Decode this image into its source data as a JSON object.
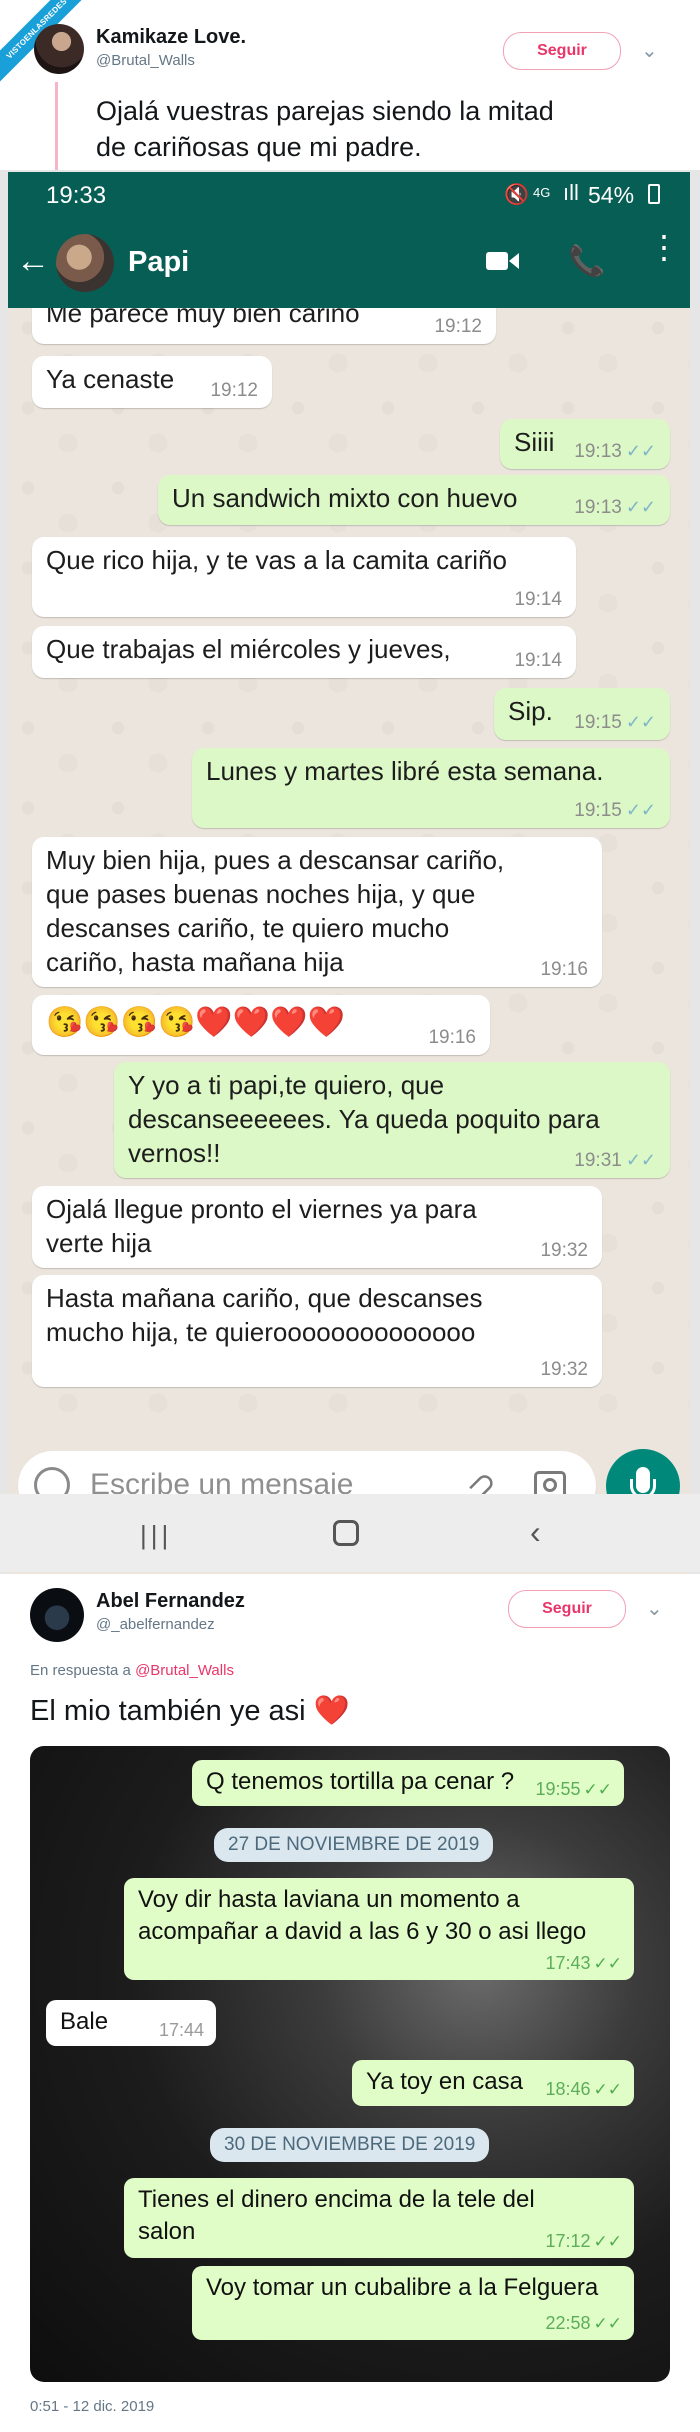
{
  "watermark": "VISTOENLASREDES",
  "tweet1": {
    "name": "Kamikaze Love.",
    "handle": "@Brutal_Walls",
    "follow_label": "Seguir",
    "text_line1": "Ojalá vuestras parejas siendo la mitad",
    "text_line2": "de cariñosas que mi padre."
  },
  "whatsapp": {
    "status_time": "19:33",
    "status_network": "4G",
    "battery": "54%",
    "contact_name": "Papi",
    "messages": [
      {
        "dir": "in",
        "text": "Me parece muy bien cariño",
        "time": "19:12"
      },
      {
        "dir": "in",
        "text": "Ya cenaste",
        "time": "19:12"
      },
      {
        "dir": "out",
        "text": "Siiii",
        "time": "19:13"
      },
      {
        "dir": "out",
        "text": "Un sandwich mixto con huevo",
        "time": "19:13"
      },
      {
        "dir": "in",
        "text": "Que rico hija, y te vas a la camita cariño",
        "time": "19:14"
      },
      {
        "dir": "in",
        "text": "Que trabajas el miércoles y jueves,",
        "time": "19:14"
      },
      {
        "dir": "out",
        "text": "Sip.",
        "time": "19:15"
      },
      {
        "dir": "out",
        "text": "Lunes y martes libré esta semana.",
        "time": "19:15"
      },
      {
        "dir": "in",
        "line1": "Muy bien hija, pues a descansar cariño,",
        "line2": "que pases buenas noches hija, y que",
        "line3": "descanses cariño, te quiero mucho",
        "line4": "cariño, hasta mañana hija",
        "time": "19:16"
      },
      {
        "dir": "in",
        "text": "😘😘😘😘❤️❤️❤️❤️",
        "time": "19:16"
      },
      {
        "dir": "out",
        "line1": "Y yo a ti papi,te quiero, que",
        "line2": "descanseeeeees. Ya queda poquito para",
        "line3": "vernos!!",
        "time": "19:31"
      },
      {
        "dir": "in",
        "line1": "Ojalá llegue pronto el viernes ya para",
        "line2": "verte hija",
        "time": "19:32"
      },
      {
        "dir": "in",
        "line1": "Hasta mañana cariño, que descanses",
        "line2": "mucho hija, te quieroooooooooooooo",
        "time": "19:32"
      }
    ],
    "input_placeholder": "Escribe un mensaje"
  },
  "tweet2": {
    "name": "Abel Fernandez",
    "handle": "@_abelfernandez",
    "follow_label": "Seguir",
    "reply_prefix": "En respuesta a",
    "reply_to": "@Brutal_Walls",
    "text": "El mio también ye asi",
    "heart": "❤️",
    "footer": "0:51 - 12 dic. 2019",
    "chat": {
      "messages": [
        {
          "dir": "out",
          "text": "Q tenemos tortilla pa cenar ?",
          "time": "19:55"
        },
        {
          "dir": "date",
          "text": "27 DE NOVIEMBRE DE 2019"
        },
        {
          "dir": "out",
          "line1": "Voy dir hasta laviana un momento a",
          "line2": "acompañar a david a las 6 y 30 o asi llego",
          "time": "17:43"
        },
        {
          "dir": "in",
          "text": "Bale",
          "time": "17:44"
        },
        {
          "dir": "out",
          "text": "Ya toy en casa",
          "time": "18:46"
        },
        {
          "dir": "date",
          "text": "30 DE NOVIEMBRE DE 2019"
        },
        {
          "dir": "out",
          "line1": "Tienes el dinero encima de la tele del",
          "line2": "salon",
          "time": "17:12"
        },
        {
          "dir": "out",
          "text": "Voy tomar un cubalibre a la Felguera",
          "time": "22:58"
        }
      ]
    }
  }
}
